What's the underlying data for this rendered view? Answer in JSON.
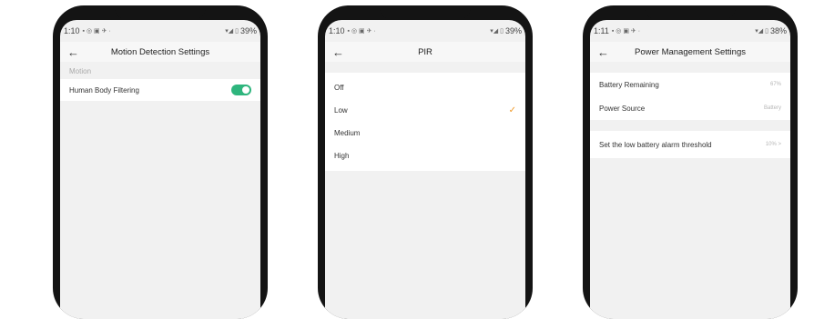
{
  "phones": [
    {
      "status": {
        "time": "1:10",
        "battery": "39%"
      },
      "title": "Motion Detection Settings",
      "section": "Motion",
      "rows": [
        {
          "label": "Human Body Filtering",
          "toggle": "on"
        }
      ]
    },
    {
      "status": {
        "time": "1:10",
        "battery": "39%"
      },
      "title": "PIR",
      "options": [
        "Off",
        "Low",
        "Medium",
        "High"
      ],
      "selected": "Low"
    },
    {
      "status": {
        "time": "1:11",
        "battery": "38%"
      },
      "title": "Power Management Settings",
      "rows": [
        {
          "label": "Battery Remaining",
          "value": "67%"
        },
        {
          "label": "Power Source",
          "value": "Battery"
        }
      ],
      "threshold": {
        "label": "Set the low battery alarm threshold",
        "value": "10% >"
      }
    }
  ],
  "icons": {
    "back": "arrow-left-icon",
    "check": "check-icon",
    "status": [
      "message-icon",
      "whatsapp-icon",
      "notification-icon",
      "wifi-icon",
      "signal-icon",
      "battery-icon"
    ]
  },
  "colors": {
    "toggle_on": "#2eb57d",
    "checkmark": "#f09a2a"
  }
}
